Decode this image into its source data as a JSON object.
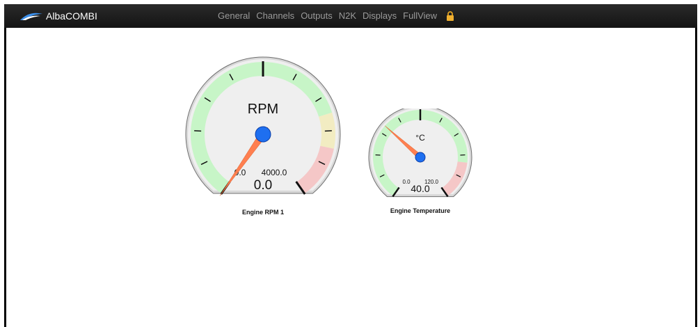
{
  "app": {
    "brand": "AlbaCOMBI"
  },
  "nav": {
    "items": [
      "General",
      "Channels",
      "Outputs",
      "N2K",
      "Displays",
      "FullView"
    ],
    "lock_icon": "lock-icon"
  },
  "gauges": [
    {
      "name": "Engine RPM 1",
      "unit_label": "RPM",
      "min_label": "0.0",
      "max_label": "4000.0",
      "value_text": "0.0",
      "min": 0,
      "max": 4000,
      "value": 0,
      "zones": [
        {
          "from": 0,
          "to": 3000,
          "color": "#c7f5c7"
        },
        {
          "from": 3000,
          "to": 3400,
          "color": "#f2ecc2"
        },
        {
          "from": 3400,
          "to": 4000,
          "color": "#f5c7c7"
        }
      ]
    },
    {
      "name": "Engine Temperature",
      "unit_label": "°C",
      "min_label": "0.0",
      "max_label": "120.0",
      "value_text": "40.0",
      "min": 0,
      "max": 120,
      "value": 40,
      "zones": [
        {
          "from": 0,
          "to": 100,
          "color": "#c7f5c7"
        },
        {
          "from": 100,
          "to": 120,
          "color": "#f5c7c7"
        }
      ]
    }
  ],
  "colors": {
    "needle": "#ff7f50",
    "hub": "#1e6ff0",
    "dial_face": "#efefef",
    "nav_text": "#9a9a9a",
    "topbar": "#1c1c1c"
  }
}
